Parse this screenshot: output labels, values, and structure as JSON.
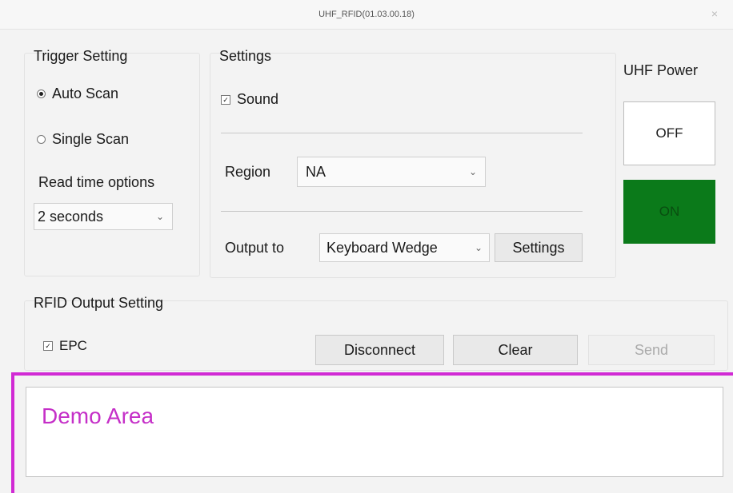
{
  "window": {
    "title": "UHF_RFID(01.03.00.18)",
    "close_glyph": "×"
  },
  "trigger": {
    "label": "Trigger Setting",
    "auto_scan": "Auto Scan",
    "single_scan": "Single Scan",
    "selected": "Auto Scan",
    "read_time_label": "Read time options",
    "read_time_value": "2 seconds"
  },
  "settings": {
    "label": "Settings",
    "sound_label": "Sound",
    "sound_checked": true,
    "region_label": "Region",
    "region_value": "NA",
    "output_label": "Output to",
    "output_value": "Keyboard Wedge",
    "settings_button": "Settings"
  },
  "power": {
    "label": "UHF Power",
    "off_label": "OFF",
    "on_label": "ON",
    "on_color": "#0b7a1a"
  },
  "rfid_output": {
    "label": "RFID Output Setting",
    "epc_label": "EPC",
    "epc_checked": true
  },
  "actions": {
    "disconnect": "Disconnect",
    "clear": "Clear",
    "send": "Send"
  },
  "demo": {
    "text": "Demo Area",
    "highlight_color": "#d12ad4"
  },
  "icons": {
    "chevron": "chevron-down-icon",
    "close": "close-icon"
  }
}
